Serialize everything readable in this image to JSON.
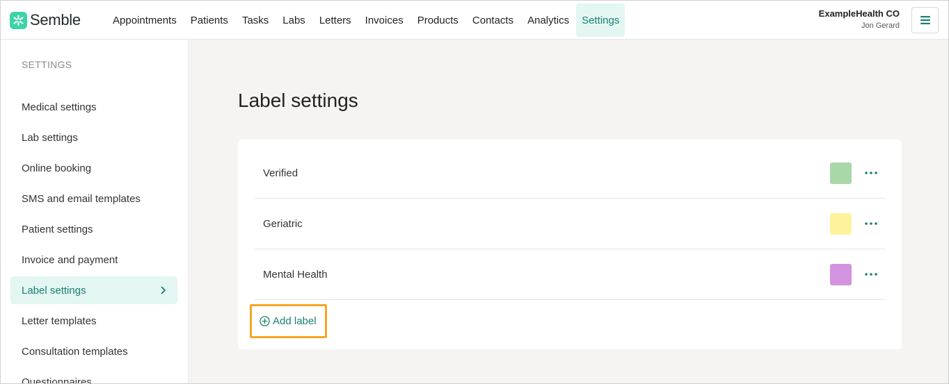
{
  "app": {
    "logo_text": "Semble",
    "brand_color": "#3bd4a6",
    "accent_color": "#1a7f72"
  },
  "nav": {
    "items": [
      {
        "label": "Appointments"
      },
      {
        "label": "Patients"
      },
      {
        "label": "Tasks"
      },
      {
        "label": "Labs"
      },
      {
        "label": "Letters"
      },
      {
        "label": "Invoices"
      },
      {
        "label": "Products"
      },
      {
        "label": "Contacts"
      },
      {
        "label": "Analytics"
      },
      {
        "label": "Settings",
        "active": true
      }
    ]
  },
  "account": {
    "org_name": "ExampleHealth CO",
    "user_name": "Jon Gerard",
    "menu_icon": "hamburger-icon"
  },
  "sidebar": {
    "heading": "SETTINGS",
    "items": [
      {
        "label": "Medical settings"
      },
      {
        "label": "Lab settings"
      },
      {
        "label": "Online booking"
      },
      {
        "label": "SMS and email templates"
      },
      {
        "label": "Patient settings"
      },
      {
        "label": "Invoice and payment"
      },
      {
        "label": "Label settings",
        "active": true
      },
      {
        "label": "Letter templates"
      },
      {
        "label": "Consultation templates"
      },
      {
        "label": "Questionnaires"
      }
    ]
  },
  "main": {
    "title": "Label settings",
    "labels": [
      {
        "name": "Verified",
        "color": "#a8d8a8"
      },
      {
        "name": "Geriatric",
        "color": "#fdf39c"
      },
      {
        "name": "Mental Health",
        "color": "#d393de"
      }
    ],
    "add_label": "Add label"
  }
}
